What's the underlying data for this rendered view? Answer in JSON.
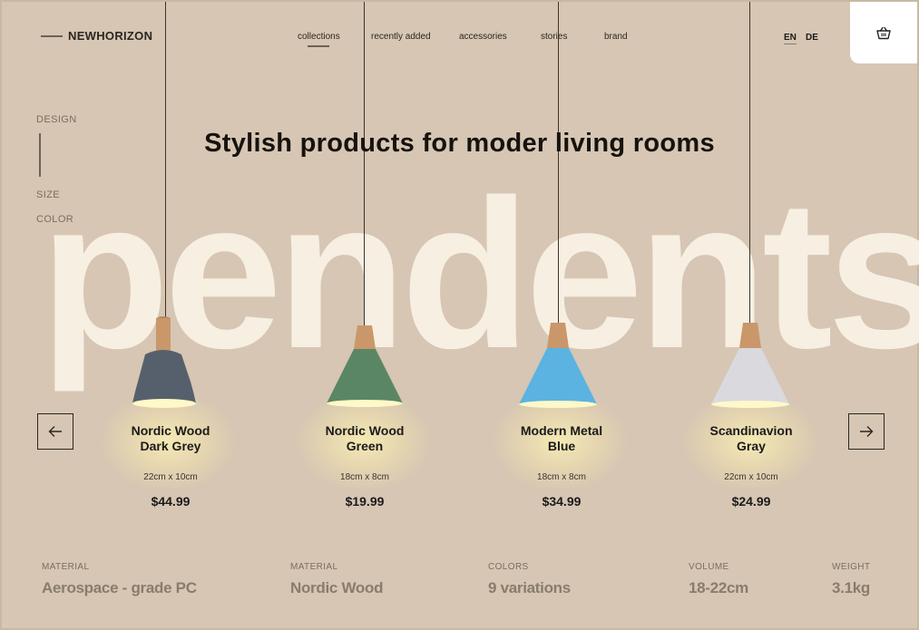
{
  "brand": {
    "name": "NEWHORIZON"
  },
  "nav": {
    "items": [
      {
        "label": "collections",
        "active": true
      },
      {
        "label": "recently added",
        "active": false
      },
      {
        "label": "accessories",
        "active": false
      },
      {
        "label": "stories",
        "active": false
      },
      {
        "label": "brand",
        "active": false
      }
    ]
  },
  "languages": [
    {
      "code": "EN",
      "active": true
    },
    {
      "code": "DE",
      "active": false
    }
  ],
  "cart": {
    "icon": "basket-icon"
  },
  "filters": {
    "design": "DESIGN",
    "size": "SIZE",
    "color": "COLOR"
  },
  "hero": {
    "headline": "Stylish products for moder living rooms",
    "background_word": "pendents"
  },
  "products": [
    {
      "name_line1": "Nordic Wood",
      "name_line2": "Dark Grey",
      "dims": "22cm x 10cm",
      "price": "$44.99",
      "shade_color": "#56606d"
    },
    {
      "name_line1": "Nordic Wood",
      "name_line2": "Green",
      "dims": "18cm x 8cm",
      "price": "$19.99",
      "shade_color": "#5b8665"
    },
    {
      "name_line1": "Modern Metal",
      "name_line2": "Blue",
      "dims": "18cm x 8cm",
      "price": "$34.99",
      "shade_color": "#5bb3e2"
    },
    {
      "name_line1": "Scandinavion",
      "name_line2": "Gray",
      "dims": "22cm x 10cm",
      "price": "$24.99",
      "shade_color": "#d9d9de"
    }
  ],
  "carousel": {
    "prev_icon": "arrow-left-icon",
    "next_icon": "arrow-right-icon"
  },
  "specs": [
    {
      "label": "MATERIAL",
      "value": "Aerospace - grade PC"
    },
    {
      "label": "MATERIAL",
      "value": "Nordic Wood"
    },
    {
      "label": "COLORS",
      "value": "9 variations"
    },
    {
      "label": "VOLUME",
      "value": "18-22cm"
    },
    {
      "label": "WEIGHT",
      "value": "3.1kg"
    }
  ],
  "colors": {
    "background": "#d6c6b3",
    "big_word": "#f7efe2",
    "wood": "#c9976a"
  }
}
